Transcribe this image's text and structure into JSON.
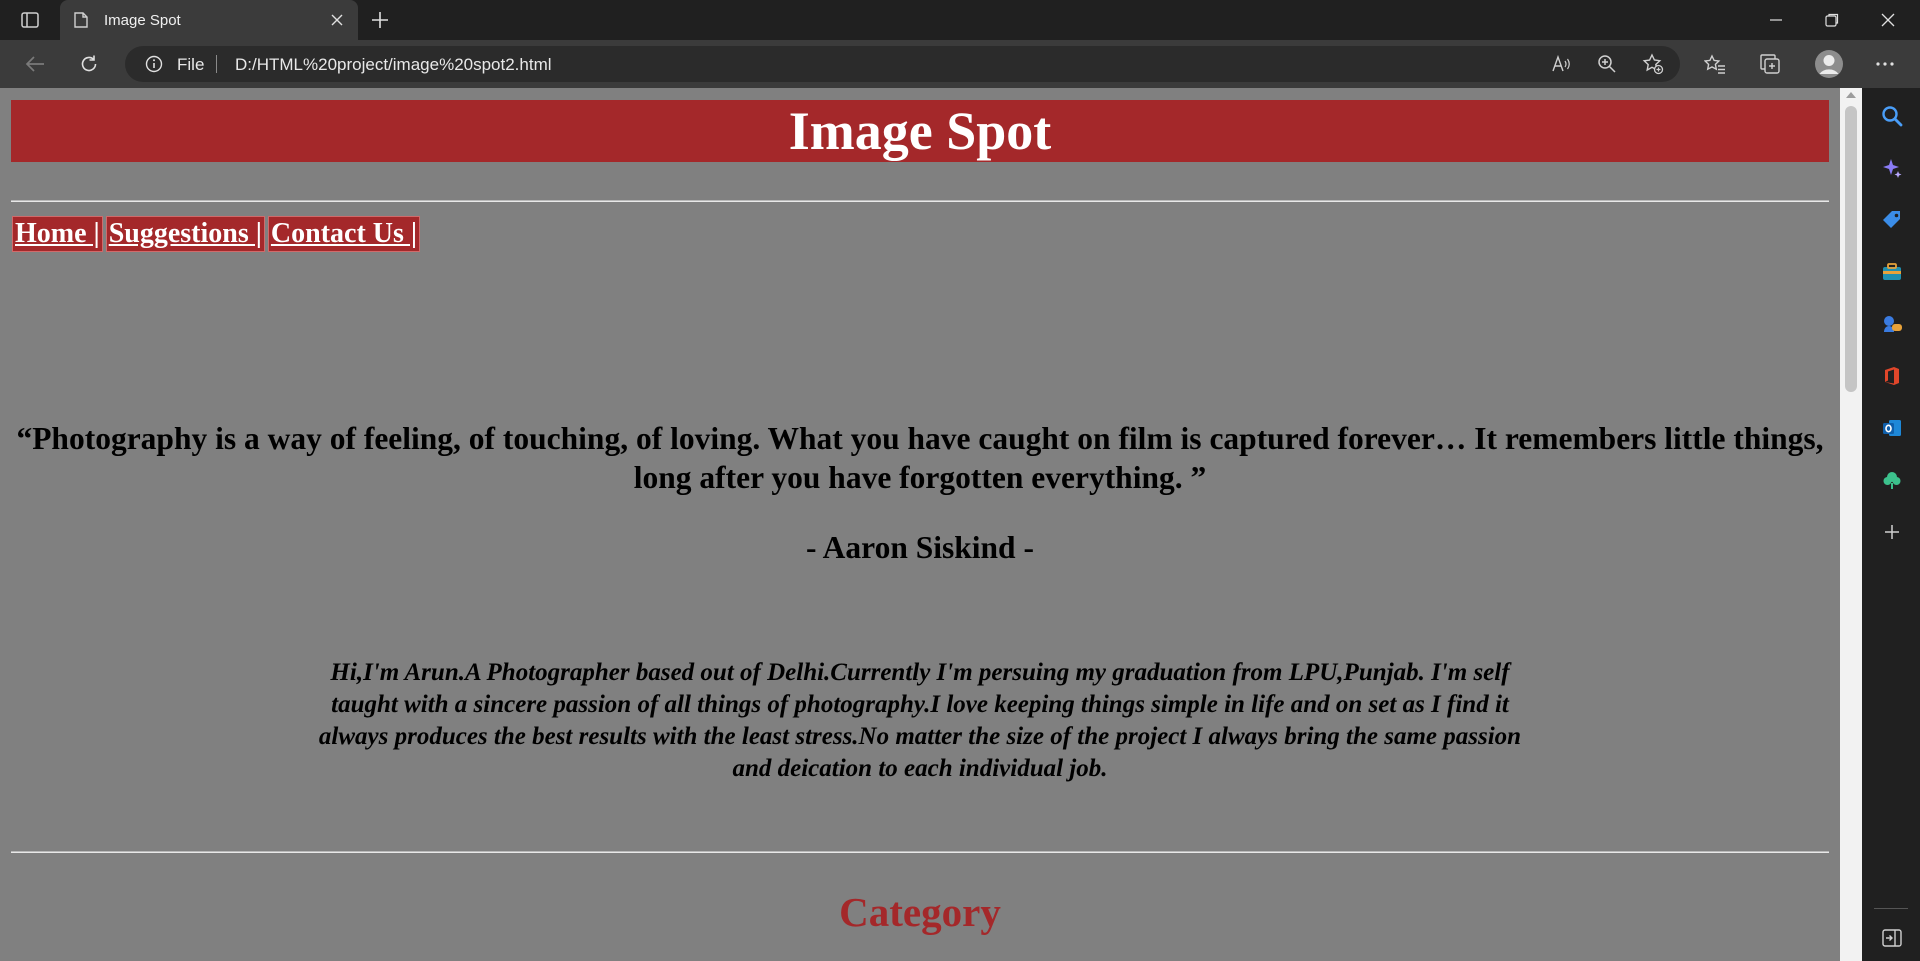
{
  "browser": {
    "tab_title": "Image Spot",
    "address_prefix": "File",
    "url": "D:/HTML%20project/image%20spot2.html"
  },
  "page": {
    "site_title": "Image Spot",
    "nav": [
      "Home |",
      "Suggestions |",
      "Contact Us |"
    ],
    "quote": "“Photography is a way of feeling, of touching, of loving. What you have caught on film is captured forever… It remembers little things, long after you have forgotten everything. ”",
    "author": "- Aaron Siskind -",
    "bio": "Hi,I'm Arun.A Photographer based out of Delhi.Currently I'm persuing my graduation from LPU,Punjab. I'm self taught with a sincere passion of all things of photography.I love keeping things simple in life and on set as I find it always produces the best results with the least stress.No matter the size of the project I always bring the same passion and deication to each individual job.",
    "section_heading": "Category"
  },
  "colors": {
    "header_bg": "#a4282a",
    "page_bg": "#808080",
    "heading_red": "#a4282a"
  },
  "icons": {
    "toolbar": [
      "back-icon",
      "refresh-icon",
      "info-icon",
      "read-aloud-icon",
      "zoom-icon",
      "add-favorite-icon",
      "favorites-icon",
      "collections-icon",
      "profile-icon",
      "more-icon"
    ],
    "sidebar": [
      "search-icon",
      "copilot-icon",
      "shopping-icon",
      "tools-icon",
      "games-icon",
      "office-icon",
      "outlook-icon",
      "tree-icon",
      "add-icon",
      "hide-sidebar-icon"
    ]
  }
}
